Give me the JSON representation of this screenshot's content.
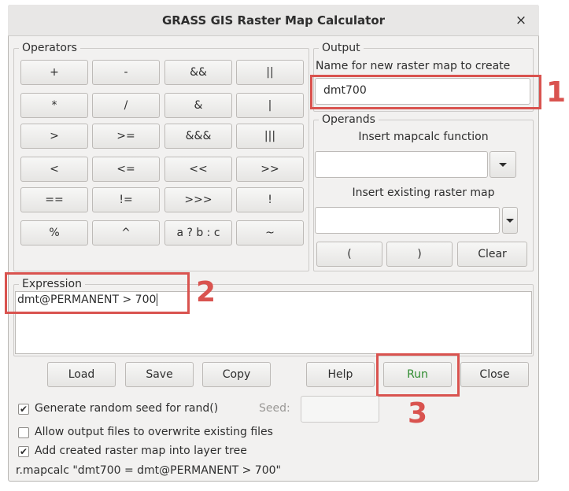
{
  "window": {
    "title": "GRASS GIS Raster Map Calculator",
    "close_glyph": "×"
  },
  "operators": {
    "legend": "Operators",
    "buttons": [
      "+",
      "-",
      "&&",
      "||",
      "*",
      "/",
      "&",
      "|",
      ">",
      ">=",
      "&&&",
      "|||",
      "<",
      "<=",
      "<<",
      ">>",
      "==",
      "!=",
      ">>>",
      "!",
      "%",
      "^",
      "a ? b : c",
      "~"
    ]
  },
  "output": {
    "legend": "Output",
    "label": "Name for new raster map to create",
    "value": "dmt700"
  },
  "operands": {
    "legend": "Operands",
    "function_label": "Insert mapcalc function",
    "function_value": "",
    "raster_label": "Insert existing raster map",
    "raster_value": "",
    "open_paren": "(",
    "close_paren": ")",
    "clear": "Clear"
  },
  "expression": {
    "legend": "Expression",
    "value": "dmt@PERMANENT > 700"
  },
  "actions": {
    "load": "Load",
    "save": "Save",
    "copy": "Copy",
    "help": "Help",
    "run": "Run",
    "close": "Close"
  },
  "options": {
    "random_seed": {
      "label": "Generate random seed for rand()",
      "checked": true
    },
    "seed_label": "Seed:",
    "seed_value": "",
    "overwrite": {
      "label": "Allow output files to overwrite existing files",
      "checked": false
    },
    "add_to_tree": {
      "label": "Add created raster map into layer tree",
      "checked": true
    }
  },
  "command_preview": "r.mapcalc \"dmt700 = dmt@PERMANENT > 700\"",
  "annotations": {
    "step1": "1",
    "step2": "2",
    "step3": "3"
  },
  "colors": {
    "annotation": "#d9534f",
    "run_text": "#2e8b2e",
    "window_bg": "#f2f1f0"
  }
}
